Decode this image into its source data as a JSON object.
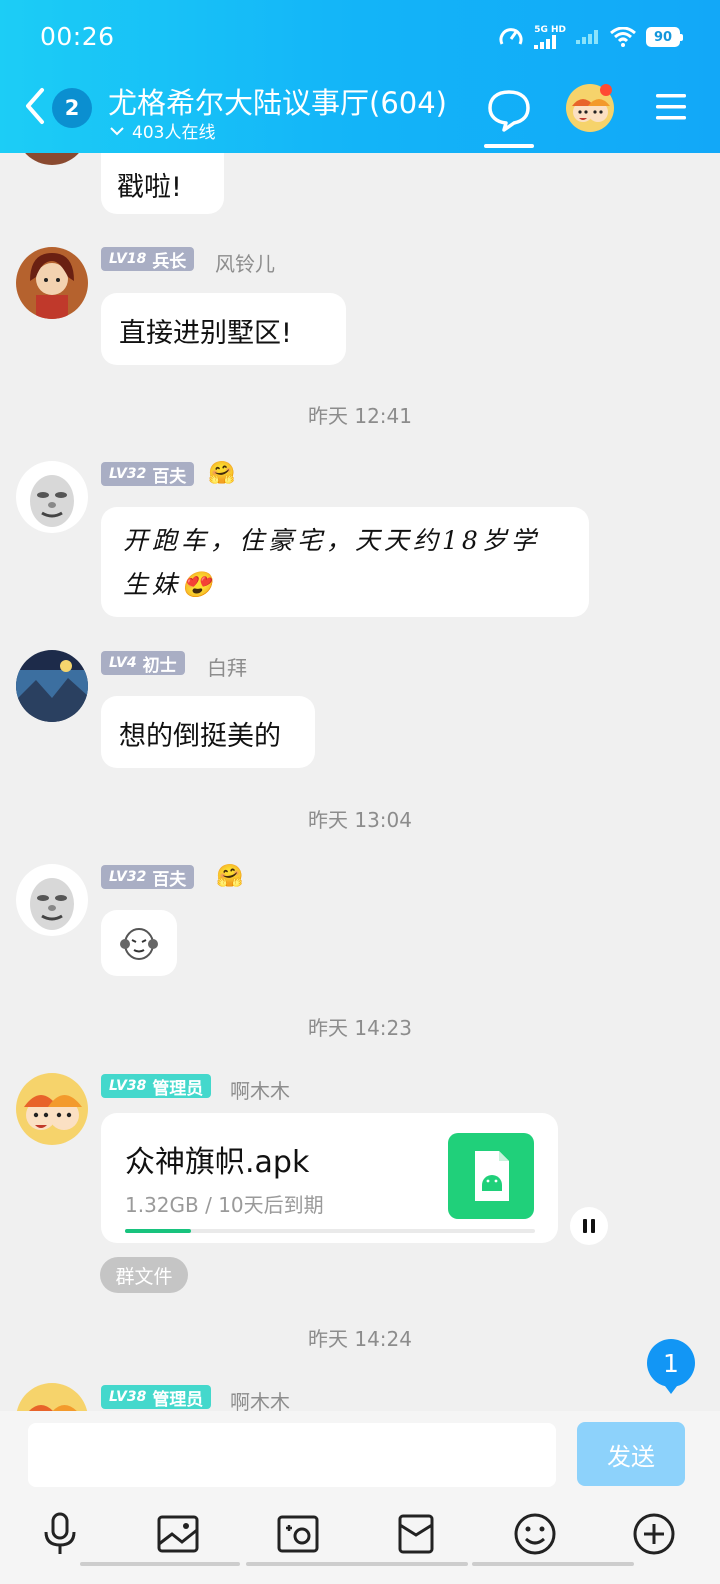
{
  "status_bar": {
    "time": "00:26",
    "network": "5G HD",
    "battery": "90"
  },
  "header": {
    "unread_count": "2",
    "group_title": "尤格希尔大陆议事厅(604)",
    "online": "403人在线"
  },
  "messages": [
    {
      "bubble_text": "戳啦!"
    },
    {
      "level": "LV18",
      "rank": "兵长",
      "nickname": "风铃儿",
      "bubble_text": "直接进别墅区!"
    },
    {
      "timestamp": "昨天 12:41"
    },
    {
      "level": "LV32",
      "rank": "百夫",
      "nickname_emoji": "🤗",
      "bubble_text": "开跑车，住豪宅，天天约18岁学生妹",
      "bubble_emoji": "😍"
    },
    {
      "level": "LV4",
      "rank": "初士",
      "nickname": "白拜",
      "bubble_text": "想的倒挺美的"
    },
    {
      "timestamp": "昨天 13:04"
    },
    {
      "level": "LV32",
      "rank": "百夫",
      "nickname_emoji": "🤗"
    },
    {
      "timestamp": "昨天 14:23"
    },
    {
      "level": "LV38",
      "rank": "管理员",
      "nickname": "啊木木",
      "file": {
        "name": "众神旗帜.apk",
        "meta": "1.32GB / 10天后到期",
        "progress": 0.16
      },
      "tag": "群文件"
    },
    {
      "timestamp": "昨天 14:24"
    },
    {
      "level": "LV38",
      "rank": "管理员",
      "nickname": "啊木木"
    }
  ],
  "new_message_count": "1",
  "input": {
    "value": "",
    "placeholder": "",
    "send_label": "发送"
  },
  "toolbar": [
    "mic-icon",
    "image-icon",
    "camera-icon",
    "red-packet-icon",
    "emoji-icon",
    "plus-icon"
  ],
  "colors": {
    "header_start": "#1ccdf6",
    "header_end": "#12a8f8",
    "level_gray": "#a9aec4",
    "level_teal": "#44d8cc",
    "send_disabled": "#8dd2fb",
    "progress": "#18c37e",
    "apk_icon": "#20d07a"
  }
}
